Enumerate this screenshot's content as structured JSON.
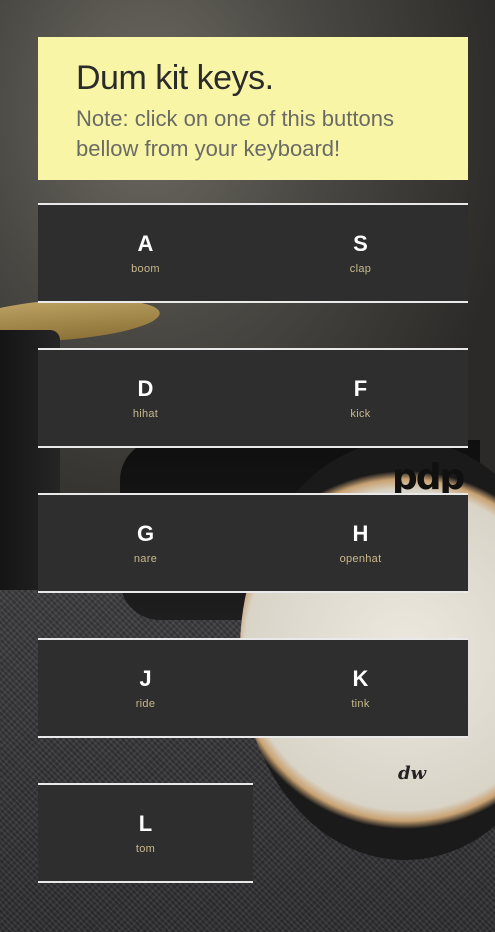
{
  "header": {
    "title": "Dum kit keys.",
    "note": "Note: click on one of this buttons bellow from your keyboard!"
  },
  "background": {
    "logo_pdp": "pdp",
    "logo_dw": "dw"
  },
  "keys": [
    {
      "letter": "A",
      "sound": "boom"
    },
    {
      "letter": "S",
      "sound": "clap"
    },
    {
      "letter": "D",
      "sound": "hihat"
    },
    {
      "letter": "F",
      "sound": "kick"
    },
    {
      "letter": "G",
      "sound": "nare"
    },
    {
      "letter": "H",
      "sound": "openhat"
    },
    {
      "letter": "J",
      "sound": "ride"
    },
    {
      "letter": "K",
      "sound": "tink"
    },
    {
      "letter": "L",
      "sound": "tom"
    }
  ],
  "colors": {
    "header_bg": "#f9f5a6",
    "key_bg": "#2e2e2e",
    "key_border": "#e9e9e9",
    "sound_label": "#c9b98c"
  }
}
